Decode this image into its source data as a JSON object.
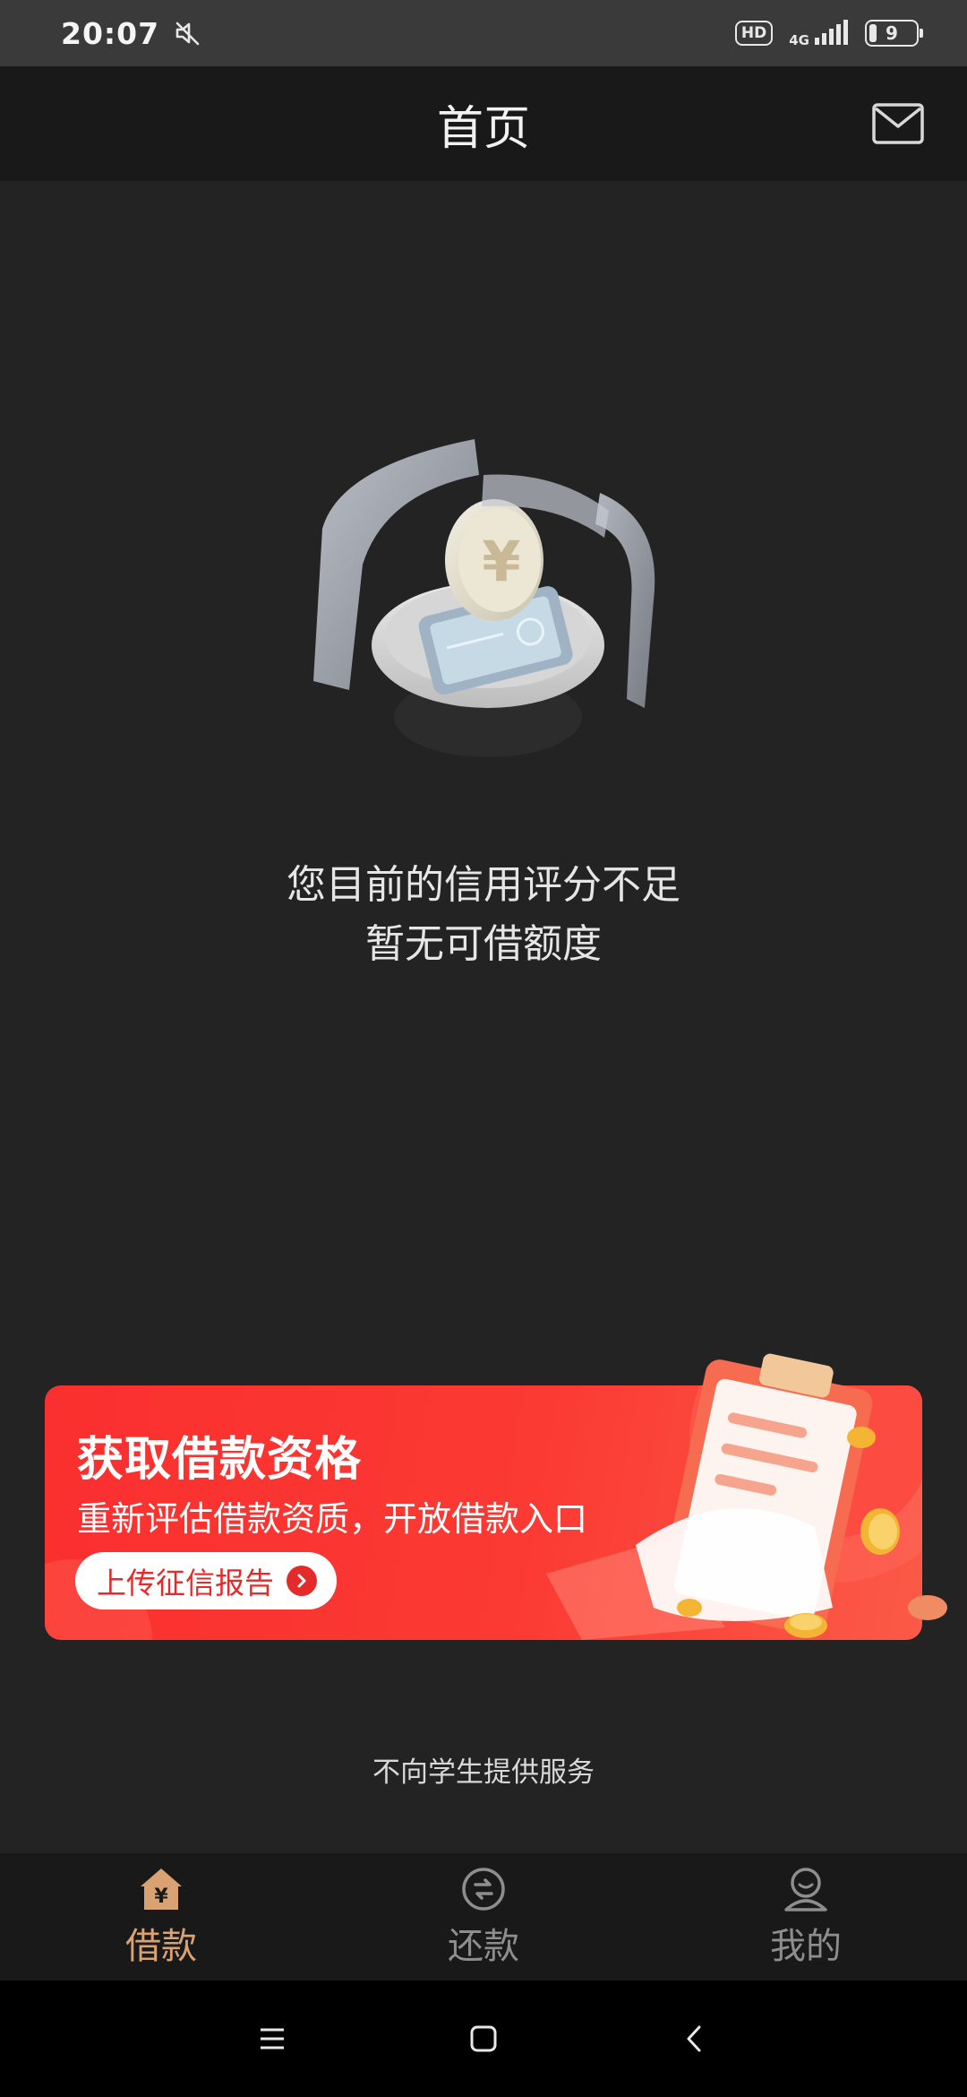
{
  "status_bar": {
    "time": "20:07",
    "hd_label": "HD",
    "network_label": "4G",
    "battery_level": "9",
    "icons": [
      "mute-icon",
      "signal-icon",
      "battery-icon"
    ]
  },
  "header": {
    "title": "首页",
    "mail_icon": "mail-icon"
  },
  "hero": {
    "illustration": "coin-phone-illustration",
    "message_line1": "您目前的信用评分不足",
    "message_line2": "暂无可借额度"
  },
  "banner": {
    "title": "获取借款资格",
    "subtitle": "重新评估借款资质，开放借款入口",
    "button_label": "上传征信报告",
    "art": "clipboard-coins-illustration",
    "colors": {
      "background": "#fa2f2f",
      "button_text": "#e52a2a"
    }
  },
  "notice": "不向学生提供服务",
  "bottom_nav": {
    "items": [
      {
        "label": "借款",
        "icon": "loan-house-icon",
        "active": true
      },
      {
        "label": "还款",
        "icon": "repay-icon",
        "active": false
      },
      {
        "label": "我的",
        "icon": "profile-icon",
        "active": false
      }
    ],
    "colors": {
      "active": "#d9a273",
      "inactive": "#8e8e8e"
    }
  },
  "system_nav": {
    "icons": [
      "menu-icon",
      "home-square-icon",
      "back-icon"
    ]
  }
}
